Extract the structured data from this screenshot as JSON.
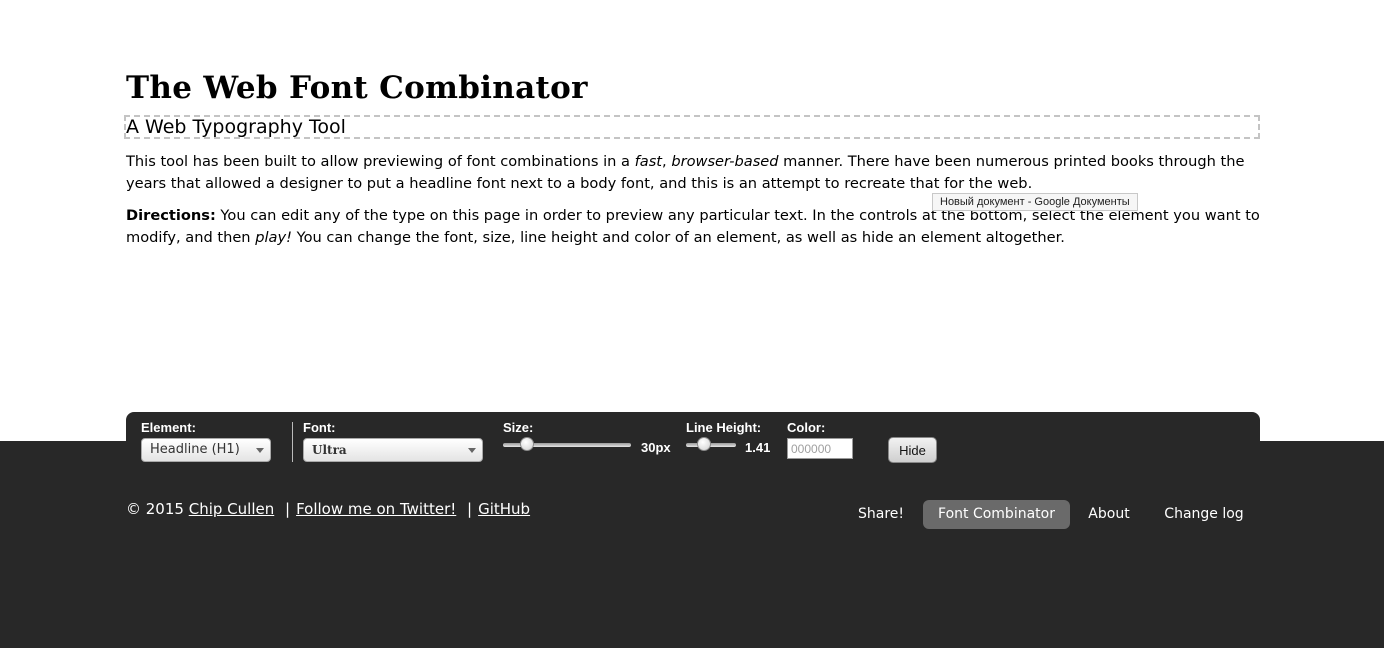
{
  "page": {
    "headline": "The Web Font Combinator",
    "subhead": "A Web Typography Tool",
    "intro": {
      "part1": "This tool has been built to allow previewing of font combinations in a ",
      "em1": "fast",
      "part2": ", ",
      "em2": "browser-based",
      "part3": " manner. There have been numerous printed books through the years that allowed a designer to put a headline font next to a body font, and this is an attempt to recreate that for the web."
    },
    "directions": {
      "label": "Directions:",
      "part1": " You can edit any of the type on this page in order to preview any particular text. In the controls at the bottom, select the element you want to modify, and then ",
      "em": "play!",
      "part2": " You can change the font, size, line height and color of an element, as well as hide an element altogether."
    },
    "tooltip": "Новый документ - Google Документы"
  },
  "controls": {
    "element_label": "Element:",
    "element_value": "Headline (H1)",
    "font_label": "Font:",
    "font_value": "Ultra",
    "size_label": "Size:",
    "size_value": "30px",
    "line_height_label": "Line Height:",
    "line_height_value": "1.41",
    "color_label": "Color:",
    "color_placeholder": "000000",
    "hide_label": "Hide"
  },
  "footer": {
    "copyright": "© 2015",
    "author_link": "Chip Cullen",
    "separator": "|",
    "twitter_link": "Follow me on Twitter!",
    "github_link": "GitHub",
    "nav": [
      {
        "label": "Share!"
      },
      {
        "label": "Font Combinator"
      },
      {
        "label": "About"
      },
      {
        "label": "Change log"
      }
    ]
  },
  "colors": {
    "footer_bg": "#282828",
    "nav_active_bg": "#6a6a6a",
    "subhead_border": "#c4c4c4"
  }
}
